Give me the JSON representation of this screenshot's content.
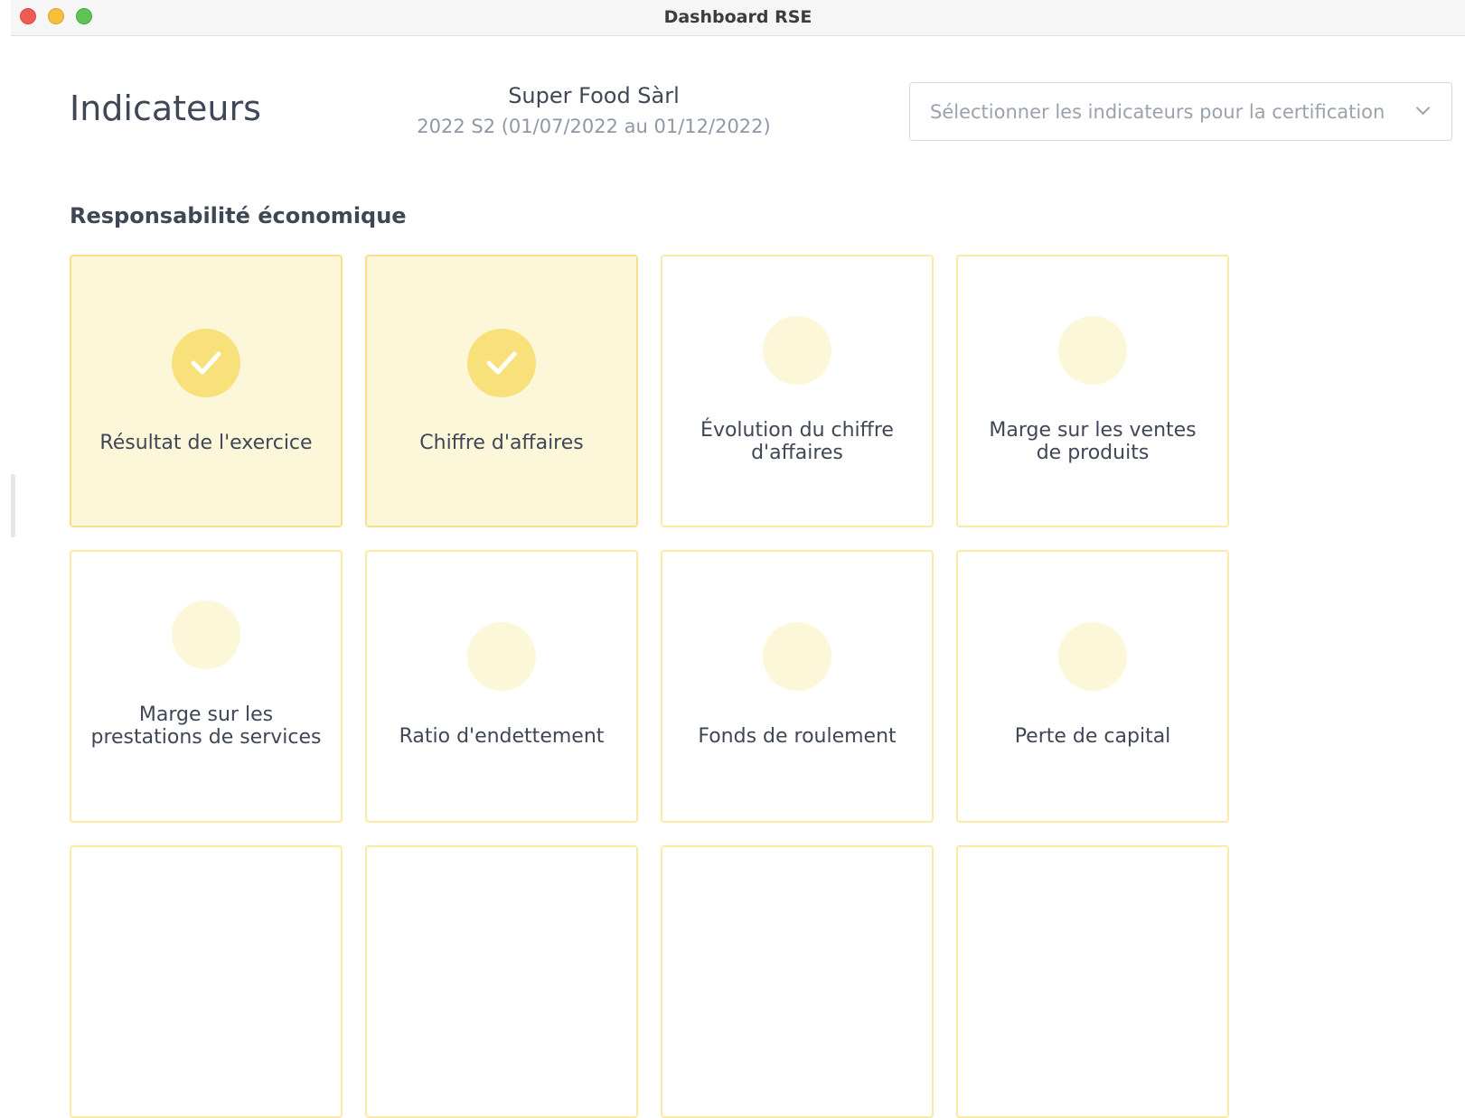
{
  "window": {
    "title": "Dashboard RSE"
  },
  "header": {
    "page_title": "Indicateurs",
    "company_name": "Super Food Sàrl",
    "period": "2022 S2 (01/07/2022 au 01/12/2022)",
    "select_placeholder": "Sélectionner les indicateurs pour la certification"
  },
  "section": {
    "title": "Responsabilité économique",
    "cards": [
      {
        "label": "Résultat de l'exercice",
        "selected": true,
        "icon": "check-icon"
      },
      {
        "label": "Chiffre d'affaires",
        "selected": true,
        "icon": "check-icon"
      },
      {
        "label": "Évolution du chiffre d'affaires",
        "selected": false
      },
      {
        "label": "Marge sur les ventes de produits",
        "selected": false
      },
      {
        "label": "Marge sur les prestations de services",
        "selected": false
      },
      {
        "label": "Ratio d'endettement",
        "selected": false
      },
      {
        "label": "Fonds de roulement",
        "selected": false
      },
      {
        "label": "Perte de capital",
        "selected": false
      }
    ]
  },
  "colors": {
    "card_border": "#fbeaa6",
    "card_selected_bg": "#fdf7d9",
    "check_circle": "#f8e07a",
    "text": "#3f4756",
    "muted": "#8f98a6"
  }
}
